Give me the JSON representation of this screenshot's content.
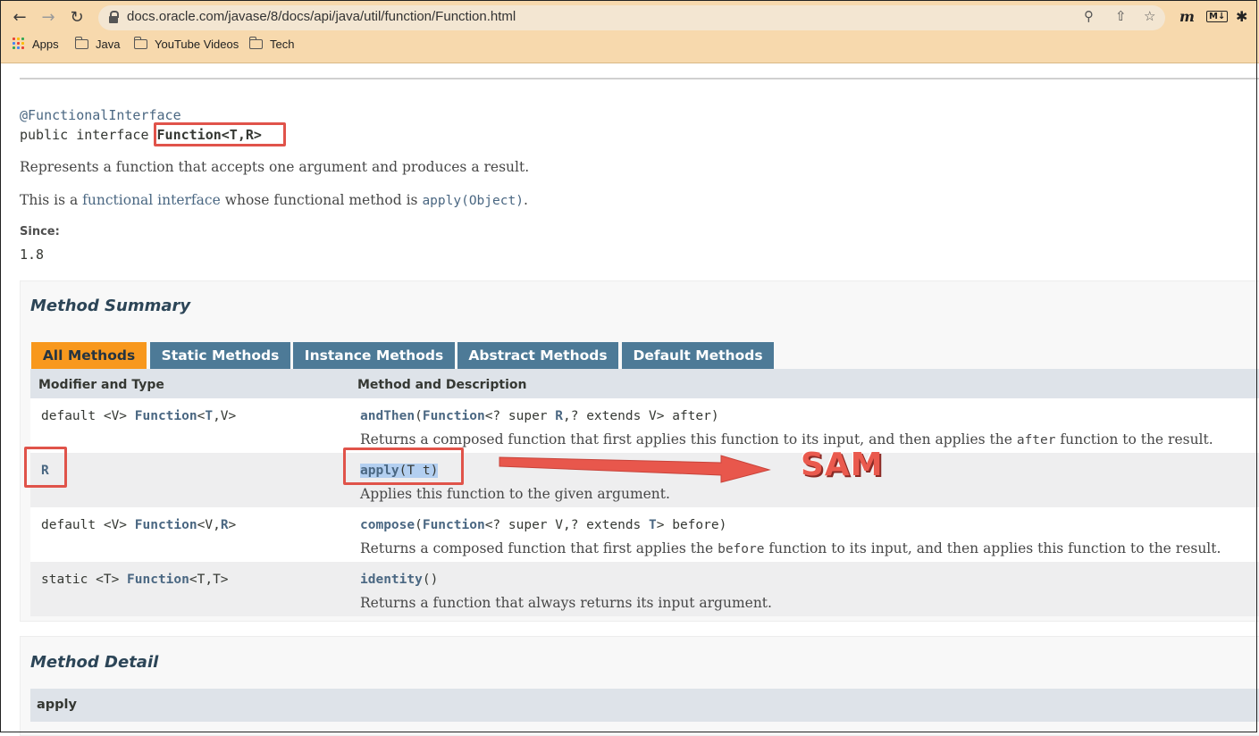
{
  "browser": {
    "url": "docs.oracle.com/javase/8/docs/api/java/util/function/Function.html",
    "bookmarks": [
      {
        "label": "Apps",
        "icon": "apps-grid-icon"
      },
      {
        "label": "Java",
        "icon": "folder-icon"
      },
      {
        "label": "YouTube Videos",
        "icon": "folder-icon"
      },
      {
        "label": "Tech",
        "icon": "folder-icon"
      }
    ],
    "extension_m": "m",
    "extension_md": "M↓"
  },
  "page": {
    "annotation": "@FunctionalInterface",
    "decl_prefix": "public interface ",
    "decl_name": "Function<T,R>",
    "description": "Represents a function that accepts one argument and produces a result.",
    "fi_text_1": "This is a ",
    "fi_link": "functional interface",
    "fi_text_2": " whose functional method is ",
    "fi_method": "apply(Object)",
    "fi_text_3": ".",
    "since_label": "Since:",
    "since_value": "1.8"
  },
  "summary": {
    "title": "Method Summary",
    "tabs": [
      "All Methods",
      "Static Methods",
      "Instance Methods",
      "Abstract Methods",
      "Default Methods"
    ],
    "active_tab": "All Methods",
    "col_type": "Modifier and Type",
    "col_method": "Method and Description",
    "rows": [
      {
        "type_pre": "default <V> ",
        "type_link": "Function",
        "type_mid": "<",
        "type_link2": "T",
        "type_post": ",V>",
        "method": "andThen",
        "sig_a": "(",
        "sig_link": "Function",
        "sig_b": "<? super ",
        "sig_link2": "R",
        "sig_c": ",? extends V> after)",
        "desc_a": "Returns a composed function that first applies this function to its input, and then applies the ",
        "desc_code": "after",
        "desc_b": " function to the result."
      },
      {
        "type_link": "R",
        "method": "apply",
        "sig": "(T t)",
        "desc": "Applies this function to the given argument."
      },
      {
        "type_pre": "default <V> ",
        "type_link": "Function",
        "type_mid": "<V,",
        "type_link2": "R",
        "type_post": ">",
        "method": "compose",
        "sig_a": "(",
        "sig_link": "Function",
        "sig_b": "<? super V,? extends ",
        "sig_link2": "T",
        "sig_c": "> before)",
        "desc_a": "Returns a composed function that first applies the ",
        "desc_code": "before",
        "desc_b": " function to its input, and then applies this function to the result."
      },
      {
        "type_pre": "static <T> ",
        "type_link": "Function",
        "type_post": "<T,T>",
        "method": "identity",
        "sig": "()",
        "desc": "Returns a function that always returns its input argument."
      }
    ]
  },
  "callout": "SAM",
  "detail": {
    "title": "Method Detail",
    "first_method": "apply"
  }
}
